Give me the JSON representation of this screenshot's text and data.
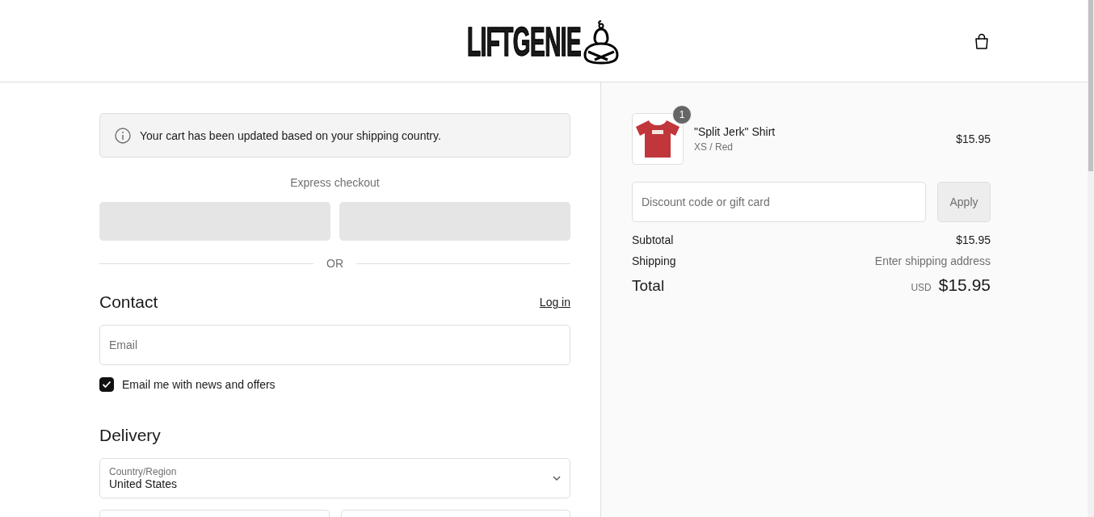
{
  "header": {
    "logo_text": "LIFTGENIE"
  },
  "notice": {
    "text": "Your cart has been updated based on your shipping country."
  },
  "express_checkout": {
    "label": "Express checkout",
    "separator": "OR"
  },
  "contact": {
    "heading": "Contact",
    "login_link": "Log in",
    "email": {
      "placeholder": "Email"
    },
    "newsletter": {
      "label": "Email me with news and offers",
      "checked": true
    }
  },
  "delivery": {
    "heading": "Delivery",
    "country": {
      "label": "Country/Region",
      "value": "United States"
    }
  },
  "order_summary": {
    "items": [
      {
        "quantity": "1",
        "name": "\"Split Jerk\" Shirt",
        "variant": "XS / Red",
        "price": "$15.95"
      }
    ],
    "discount": {
      "placeholder": "Discount code or gift card",
      "button": "Apply"
    },
    "lines": [
      {
        "label": "Subtotal",
        "value": "$15.95",
        "kind": "amount"
      },
      {
        "label": "Shipping",
        "value": "Enter shipping address",
        "kind": "note"
      }
    ],
    "total": {
      "label": "Total",
      "currency": "USD",
      "value": "$15.95"
    }
  }
}
